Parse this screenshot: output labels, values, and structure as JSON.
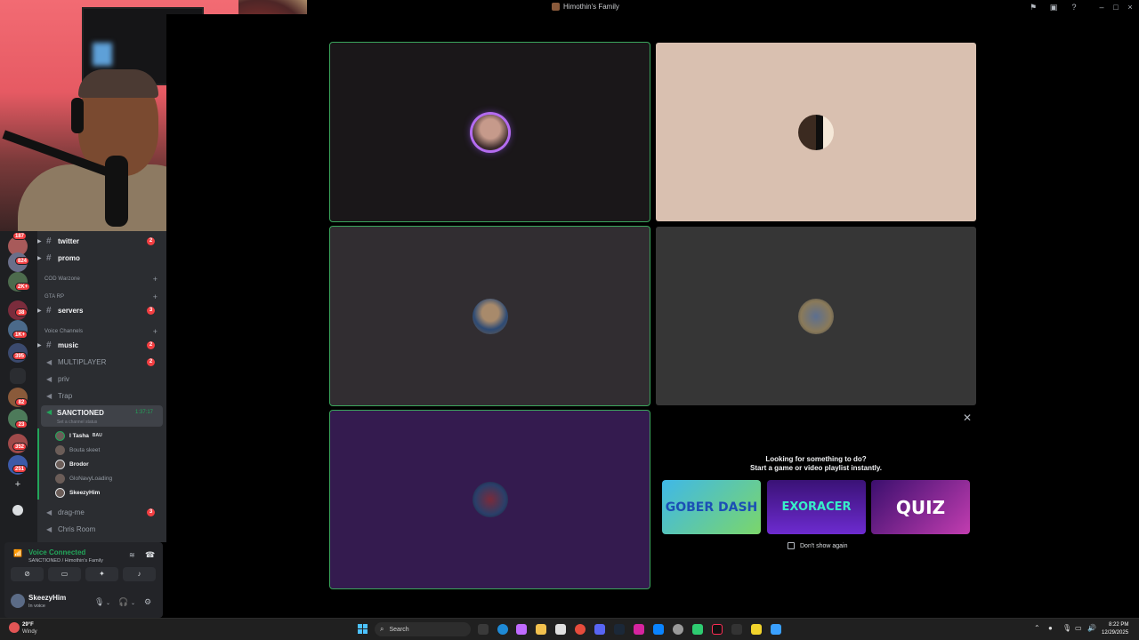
{
  "window": {
    "title": "Himothin's Family"
  },
  "servers": {
    "badges": [
      "187",
      "824",
      "2K+",
      "38",
      "1K+",
      "395",
      "82",
      "23",
      "352",
      "251"
    ]
  },
  "channels": {
    "text": [
      {
        "name": "twitter",
        "badge": "2"
      },
      {
        "name": "promo",
        "badge": ""
      }
    ],
    "categories": [
      "COD Warzone",
      "GTA RP",
      "Voice Channels"
    ],
    "servers_channel": {
      "name": "servers",
      "badge": "3"
    },
    "music": {
      "name": "music",
      "badge": "2"
    },
    "voice": [
      {
        "name": "MULTIPLAYER",
        "badge": "2"
      },
      {
        "name": "priv",
        "badge": ""
      },
      {
        "name": "Trap",
        "badge": ""
      }
    ],
    "active": {
      "name": "SANCTIONED",
      "timer": "1:37:17",
      "status": "Set a channel status"
    },
    "active_users": [
      {
        "name": "I Tasha",
        "tag": "BAU"
      },
      {
        "name": "Bouta skeet",
        "tag": ""
      },
      {
        "name": "Brodor",
        "tag": ""
      },
      {
        "name": "GloNavyLoading",
        "tag": ""
      },
      {
        "name": "SkeezyHim",
        "tag": ""
      }
    ],
    "after": [
      {
        "name": "drag-me",
        "badge": "3"
      },
      {
        "name": "Chris Room",
        "badge": ""
      }
    ]
  },
  "voice_panel": {
    "title": "Voice Connected",
    "subtitle": "SANCTIONED / Himothin's Family",
    "user_name": "SkeezyHim",
    "user_status": "In voice"
  },
  "activity": {
    "line1": "Looking for something to do?",
    "line2": "Start a game or video playlist instantly.",
    "games": [
      "GOBER DASH",
      "EXORACER",
      "QUIZ"
    ],
    "dont_show": "Don't show again"
  },
  "taskbar": {
    "weather_temp": "29°F",
    "weather_desc": "Windy",
    "search": "Search",
    "time": "8:22 PM",
    "date": "12/29/2025"
  },
  "colors": {
    "speaking_green": "#3ba55c",
    "danger": "#f23f42",
    "discord_bg": "#2b2d31"
  }
}
